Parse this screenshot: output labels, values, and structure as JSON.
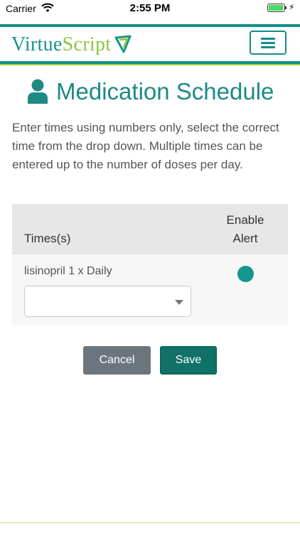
{
  "status_bar": {
    "carrier": "Carrier",
    "time": "2:55 PM",
    "battery_level": 1.0,
    "battery_color": "#4cd964"
  },
  "header": {
    "logo_primary": "Virtue",
    "logo_secondary": "Script",
    "logo_icon": "virtuescript-mark-icon",
    "menu_icon": "hamburger-menu-icon",
    "brand_teal": "#128e85",
    "brand_green": "#8cc63e"
  },
  "page": {
    "title": "Medication Schedule",
    "title_icon": "user-icon",
    "intro": "Enter times using numbers only, select the correct time from the drop down. Multiple times can be entered up to the number of doses per day."
  },
  "table": {
    "col_times": "Times(s)",
    "col_alert": "Enable Alert",
    "row": {
      "medication": "lisinopril 1 x Daily",
      "time_value": "",
      "alert_enabled": true
    }
  },
  "buttons": {
    "cancel": "Cancel",
    "save": "Save",
    "cancel_color": "#6c757d",
    "save_color": "#0f7168"
  }
}
